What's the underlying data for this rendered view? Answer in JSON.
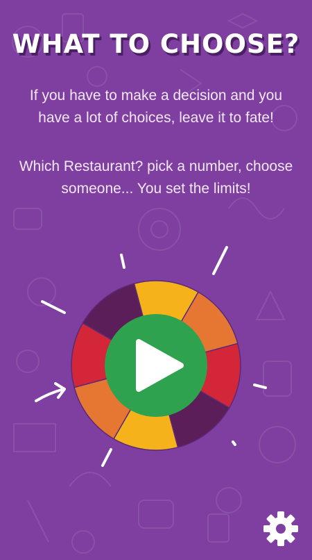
{
  "title": "WHAT TO CHOOSE?",
  "description_1": "If you have to make a decision and you have a lot of choices, leave it to fate!",
  "description_2": "Which Restaurant? pick a number, choose someone... You set the limits!",
  "icons": {
    "play": "play-icon",
    "settings": "gear-icon",
    "arrow": "arrow-icon"
  },
  "colors": {
    "background": "#7E3FA0",
    "segments": [
      "#F5B21A",
      "#E57732",
      "#D32638",
      "#5C1E58",
      "#F5B21A",
      "#E57732",
      "#D32638",
      "#5C1E58"
    ],
    "play_button": "#2EA24F",
    "white": "#FFFFFF"
  }
}
